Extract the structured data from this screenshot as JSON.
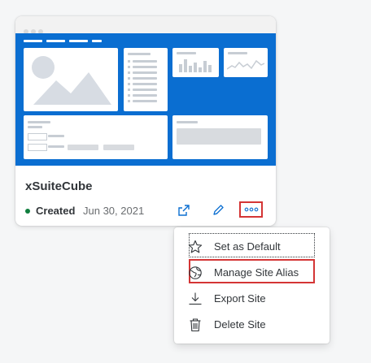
{
  "card": {
    "title": "xSuiteCube",
    "status_label": "Created",
    "status_date": "Jun 30, 2021",
    "status_color": "#107e3e",
    "thumbnail_color": "#0a6ed1",
    "actions": [
      "share-icon",
      "edit-icon",
      "more-icon"
    ]
  },
  "menu": {
    "items": [
      {
        "label": "Set as Default",
        "icon": "star-icon"
      },
      {
        "label": "Manage Site Alias",
        "icon": "globe-icon"
      },
      {
        "label": "Export Site",
        "icon": "download-icon"
      },
      {
        "label": "Delete Site",
        "icon": "trash-icon"
      }
    ]
  },
  "highlight_color": "#d43535"
}
